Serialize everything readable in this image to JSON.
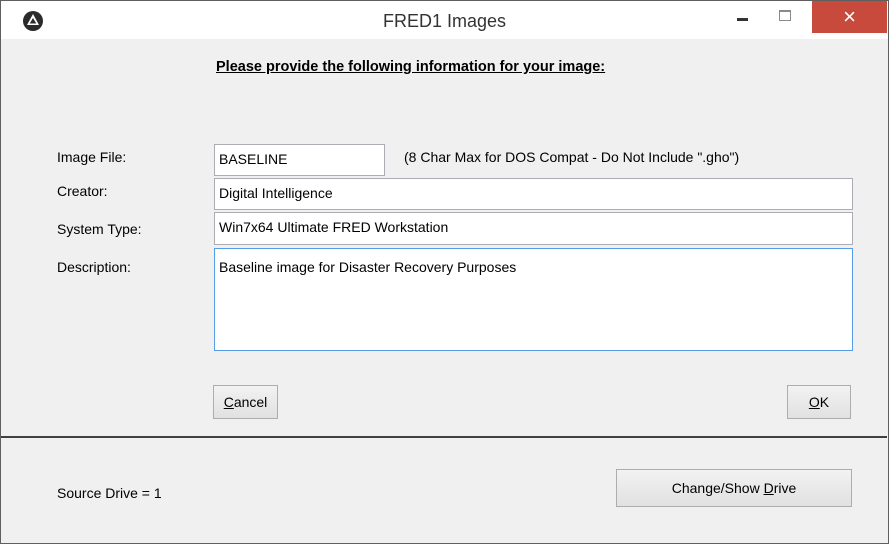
{
  "window": {
    "title": "FRED1 Images",
    "controls": {
      "minimize": "minimize",
      "maximize": "maximize",
      "close": "×"
    }
  },
  "form": {
    "heading": "Please provide the following information for your image:",
    "image_file": {
      "label": "Image File:",
      "value": "BASELINE",
      "hint": "(8 Char Max for DOS Compat - Do Not Include \".gho\")"
    },
    "creator": {
      "label": "Creator:",
      "value": "Digital Intelligence"
    },
    "system_type": {
      "label": "System Type:",
      "value": "Win7x64 Ultimate FRED Workstation"
    },
    "description": {
      "label": "Description:",
      "value": "Baseline image for Disaster Recovery Purposes"
    }
  },
  "buttons": {
    "cancel": {
      "accel": "C",
      "rest": "ancel"
    },
    "ok": {
      "accel": "O",
      "rest": "K"
    },
    "change_drive": {
      "pre": "Change/Show ",
      "accel": "D",
      "rest": "rive"
    }
  },
  "status": {
    "source_drive": "Source Drive = 1"
  }
}
